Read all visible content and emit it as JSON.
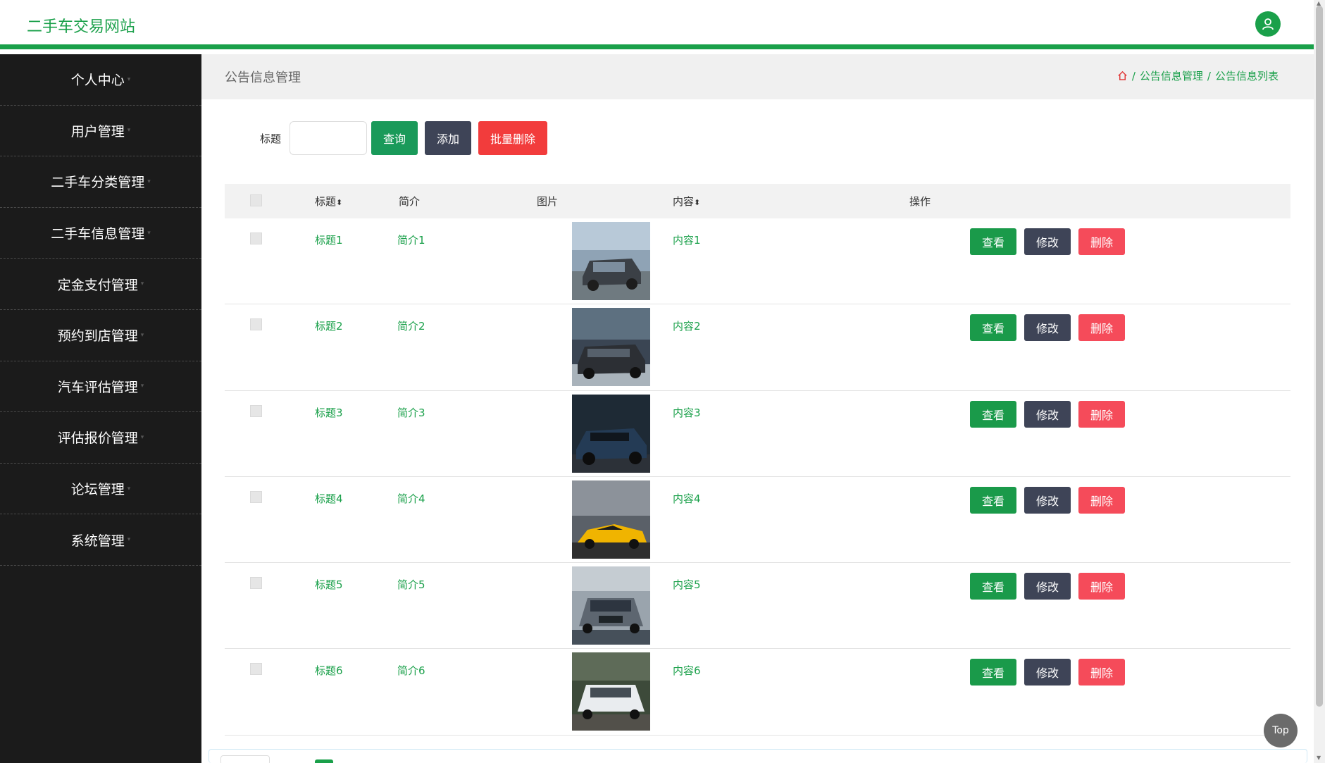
{
  "header": {
    "title": "二手车交易网站"
  },
  "sidebar": {
    "items": [
      {
        "label": "个人中心"
      },
      {
        "label": "用户管理"
      },
      {
        "label": "二手车分类管理"
      },
      {
        "label": "二手车信息管理"
      },
      {
        "label": "定金支付管理"
      },
      {
        "label": "预约到店管理"
      },
      {
        "label": "汽车评估管理"
      },
      {
        "label": "评估报价管理"
      },
      {
        "label": "论坛管理"
      },
      {
        "label": "系统管理"
      }
    ]
  },
  "page": {
    "title": "公告信息管理",
    "breadcrumb": [
      "公告信息管理",
      "公告信息列表"
    ]
  },
  "search": {
    "label": "标题",
    "placeholder": "",
    "query_label": "查询",
    "add_label": "添加",
    "batch_delete_label": "批量删除"
  },
  "table": {
    "headers": {
      "title": "标题",
      "intro": "简介",
      "image": "图片",
      "content": "内容",
      "actions": "操作"
    },
    "rows": [
      {
        "title": "标题1",
        "intro": "简介1",
        "content": "内容1"
      },
      {
        "title": "标题2",
        "intro": "简介2",
        "content": "内容2"
      },
      {
        "title": "标题3",
        "intro": "简介3",
        "content": "内容3"
      },
      {
        "title": "标题4",
        "intro": "简介4",
        "content": "内容4"
      },
      {
        "title": "标题5",
        "intro": "简介5",
        "content": "内容5"
      },
      {
        "title": "标题6",
        "intro": "简介6",
        "content": "内容6"
      }
    ],
    "row_actions": {
      "view": "查看",
      "edit": "修改",
      "delete": "删除"
    }
  },
  "top_button": "Top",
  "colors": {
    "accent": "#1aa04a",
    "sidebar_bg": "#1b1b1b",
    "dark_button": "#3e4457",
    "danger": "#f23c3c"
  }
}
